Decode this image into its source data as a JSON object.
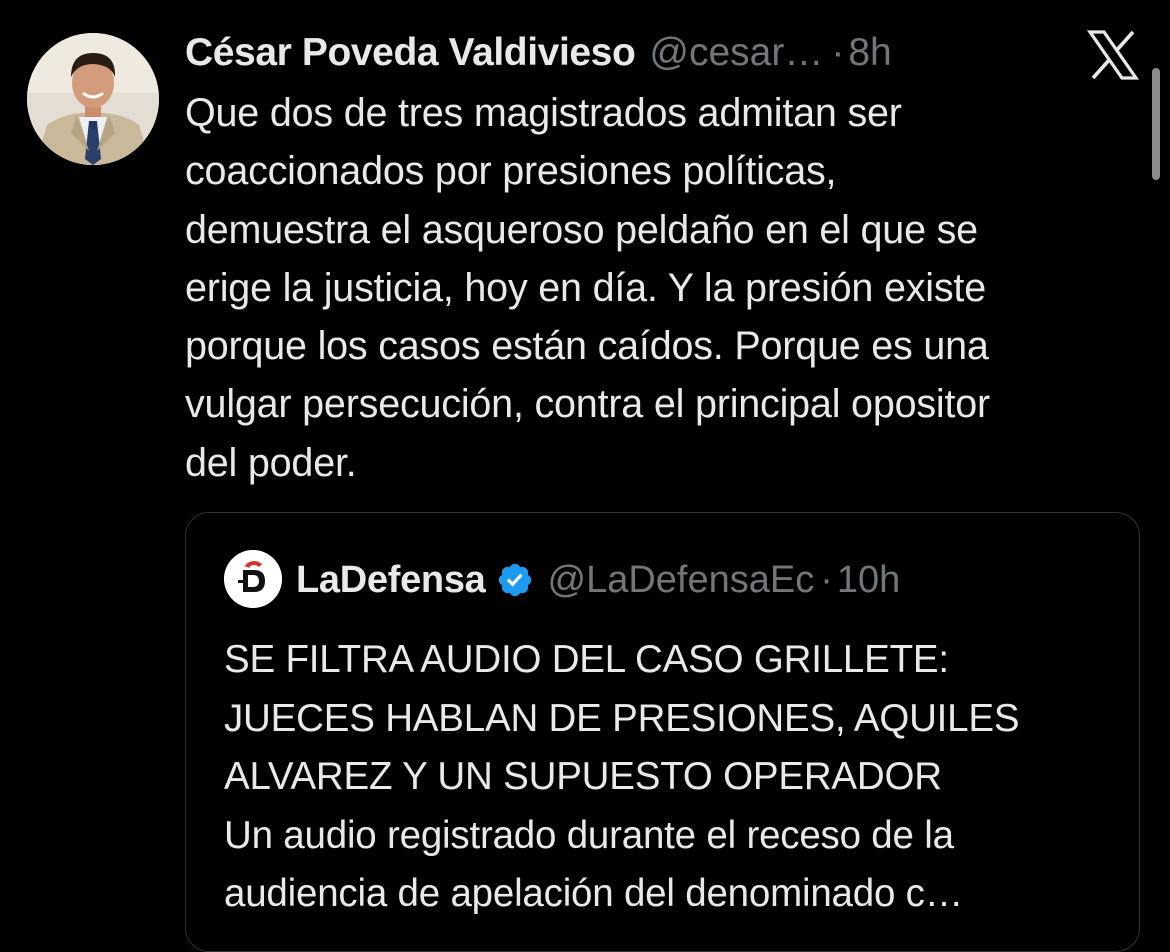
{
  "tweet": {
    "author": {
      "display_name": "César Poveda Valdivieso",
      "handle": "@cesar…",
      "time": "8h",
      "separator": "·"
    },
    "text": "Que dos de tres magistrados admitan ser\ncoaccionados por presiones políticas,\ndemuestra el asqueroso peldaño en el que se\nerige la justicia, hoy en día. Y la presión existe\nporque los casos están caídos. Porque es una\nvulgar persecución, contra el principal opositor\ndel poder.",
    "close_icon": "x-icon"
  },
  "quoted_tweet": {
    "author": {
      "display_name": "LaDefensa",
      "handle": "@LaDefensaEc",
      "time": "10h",
      "separator": "·",
      "verified_icon": "verified-badge-icon"
    },
    "text": "SE FILTRA AUDIO DEL CASO GRILLETE:\nJUECES HABLAN DE PRESIONES, AQUILES\nALVAREZ Y UN SUPUESTO OPERADOR\nUn audio registrado durante el receso de la\naudiencia de apelación del denominado c…"
  },
  "colors": {
    "background": "#000000",
    "primary_text": "#e7e9ea",
    "secondary_text": "#71767b",
    "border": "#2f3336",
    "verified_blue": "#1d9bf0",
    "brand_red": "#d6302b"
  }
}
